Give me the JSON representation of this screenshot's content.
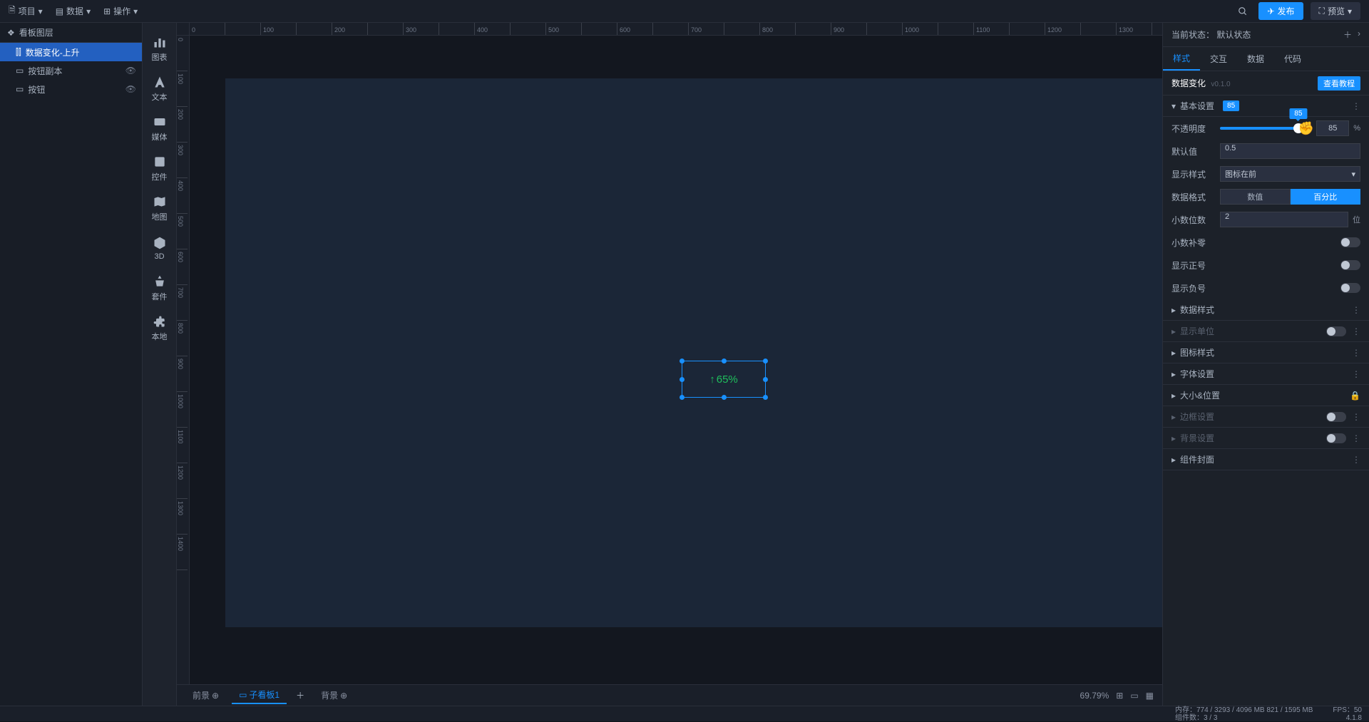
{
  "menubar": {
    "project": "项目",
    "data": "数据",
    "actions": "操作",
    "publish": "发布",
    "preview": "预览"
  },
  "layers": {
    "title": "看板图层",
    "items": [
      {
        "label": "数据变化-上升",
        "selected": true
      },
      {
        "label": "按钮副本",
        "selected": false,
        "eye": true
      },
      {
        "label": "按钮",
        "selected": false,
        "eye": true
      }
    ]
  },
  "compToolbar": [
    {
      "id": "chart",
      "label": "图表"
    },
    {
      "id": "text",
      "label": "文本"
    },
    {
      "id": "media",
      "label": "媒体"
    },
    {
      "id": "control",
      "label": "控件"
    },
    {
      "id": "map",
      "label": "地图"
    },
    {
      "id": "3d",
      "label": "3D"
    },
    {
      "id": "kit",
      "label": "套件"
    },
    {
      "id": "local",
      "label": "本地"
    }
  ],
  "canvas": {
    "widget_value": "65%",
    "zoom": "69.79%"
  },
  "bottomTabs": {
    "foreground": "前景",
    "sub_board": "子看板1",
    "background": "背景"
  },
  "rightPanel": {
    "state_label": "当前状态：",
    "state_value": "默认状态",
    "tabs": {
      "style": "样式",
      "interact": "交互",
      "data": "数据",
      "code": "代码"
    },
    "component_title": "数据变化",
    "component_version": "v0.1.0",
    "tutorial": "查看教程",
    "sections": {
      "basic": "基本设置",
      "opacity_label": "不透明度",
      "opacity_value": "85",
      "opacity_unit": "%",
      "opacity_badge": "85",
      "default_label": "默认值",
      "default_value": "0.5",
      "display_mode_label": "显示样式",
      "display_mode_value": "图标在前",
      "data_format_label": "数据格式",
      "fmt_number": "数值",
      "fmt_percent": "百分比",
      "decimals_label": "小数位数",
      "decimals_value": "2",
      "decimals_unit": "位",
      "pad_zero_label": "小数补零",
      "show_plus_label": "显示正号",
      "show_minus_label": "显示负号",
      "data_style": "数据样式",
      "display_unit": "显示单位",
      "icon_style": "图标样式",
      "font_settings": "字体设置",
      "size_pos": "大小&位置",
      "border_settings": "边框设置",
      "bg_settings": "背景设置",
      "comp_cover": "组件封面"
    }
  },
  "statusbar": {
    "memory": "内存：774 / 3293 / 4096 MB  821 / 1595 MB",
    "fps": "FPS：50",
    "components": "组件数：3 / 3",
    "version": "4.1.8"
  }
}
